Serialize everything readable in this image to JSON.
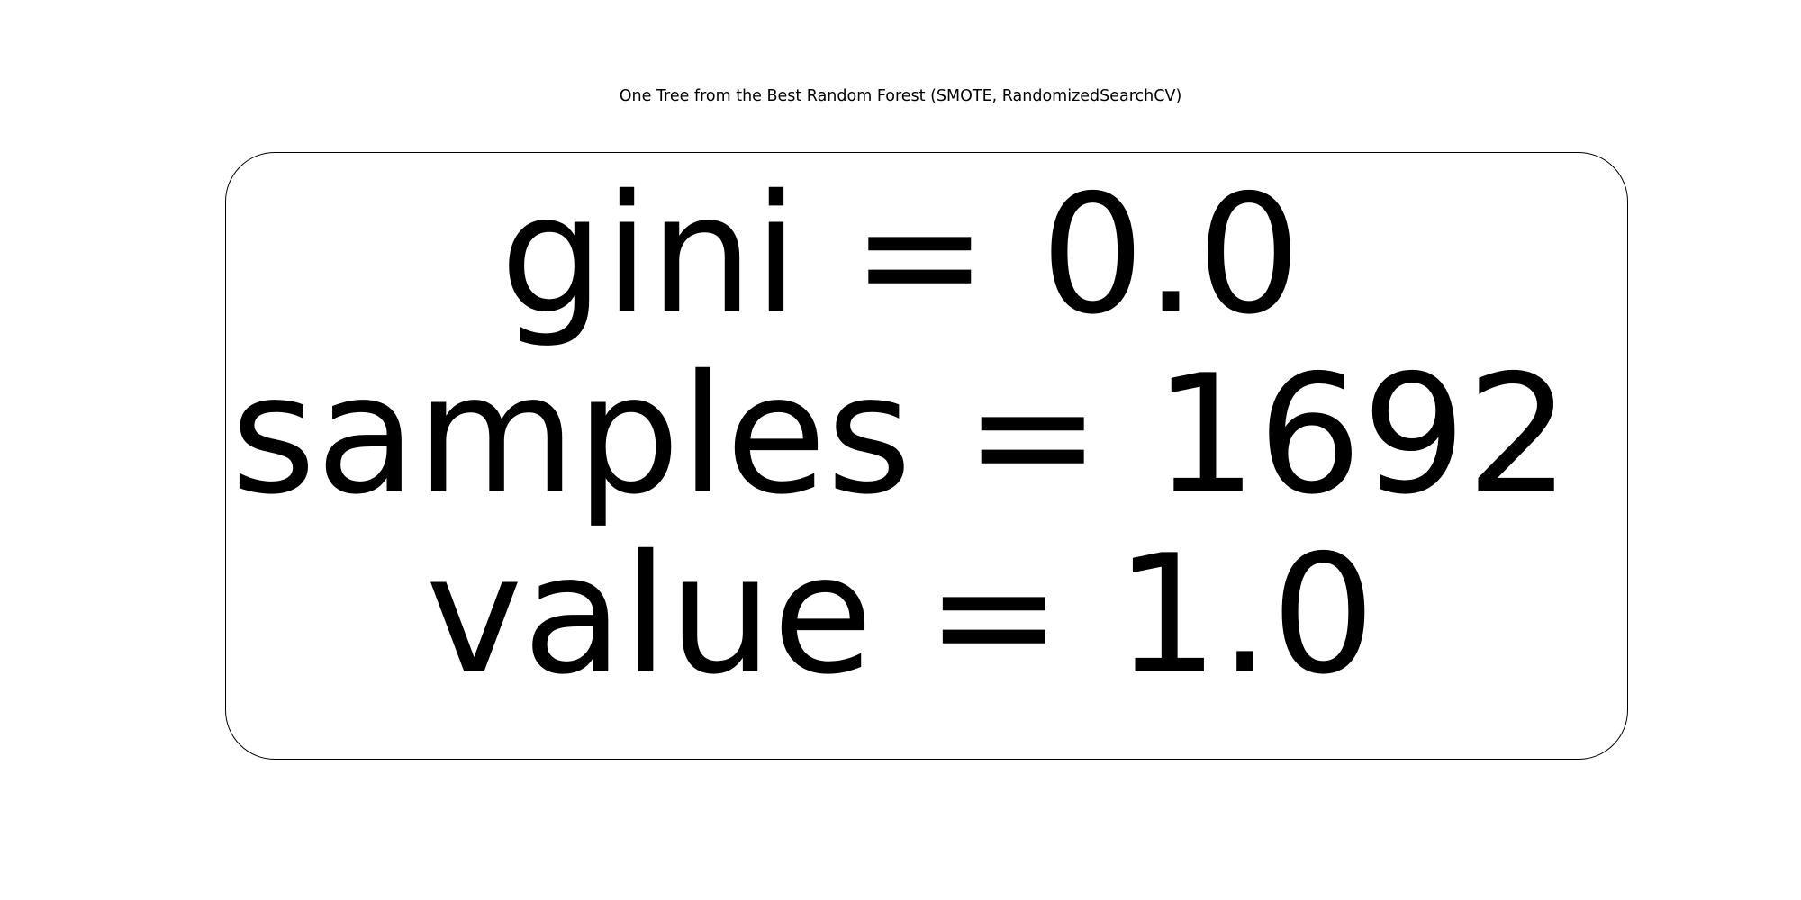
{
  "figure": {
    "title": "One Tree from the Best Random Forest (SMOTE, RandomizedSearchCV)"
  },
  "tree": {
    "nodes": [
      {
        "gini_text": "gini = 0.0",
        "samples_text": "samples = 1692",
        "value_text": "value = 1.0",
        "gini": 0.0,
        "samples": 1692,
        "value": 1.0
      }
    ]
  },
  "colors": {
    "background": "#ffffff",
    "text": "#000000",
    "node_border": "#000000",
    "node_fill": "#ffffff"
  }
}
